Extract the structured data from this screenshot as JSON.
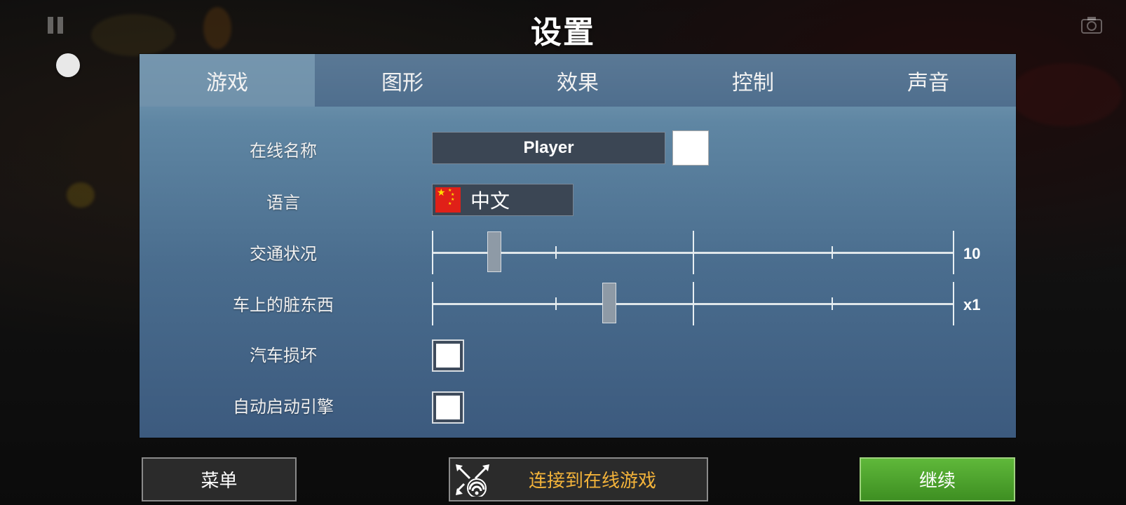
{
  "title": "设置",
  "tabs": [
    {
      "label": "游戏",
      "active": true
    },
    {
      "label": "图形",
      "active": false
    },
    {
      "label": "效果",
      "active": false
    },
    {
      "label": "控制",
      "active": false
    },
    {
      "label": "声音",
      "active": false
    }
  ],
  "settings": {
    "online_name": {
      "label": "在线名称",
      "value": "Player",
      "color": "#ffffff"
    },
    "language": {
      "label": "语言",
      "value": "中文",
      "flag_icon": "china-flag-icon"
    },
    "traffic": {
      "label": "交通状况",
      "value_text": "10",
      "level_fraction": 0.12
    },
    "car_dirt": {
      "label": "车上的脏东西",
      "value_text": "x1",
      "level_fraction": 0.34
    },
    "car_damage": {
      "label": "汽车损坏",
      "checked": false
    },
    "auto_start_engine": {
      "label": "自动启动引擎",
      "checked": false
    }
  },
  "buttons": {
    "menu": "菜单",
    "connect_online": "连接到在线游戏",
    "continue": "继续"
  },
  "colors": {
    "accent_green": "#4aa02c",
    "online_text": "#f3b33a",
    "panel_top": "#7fa3b8",
    "panel_bottom": "#3c5a7e"
  }
}
